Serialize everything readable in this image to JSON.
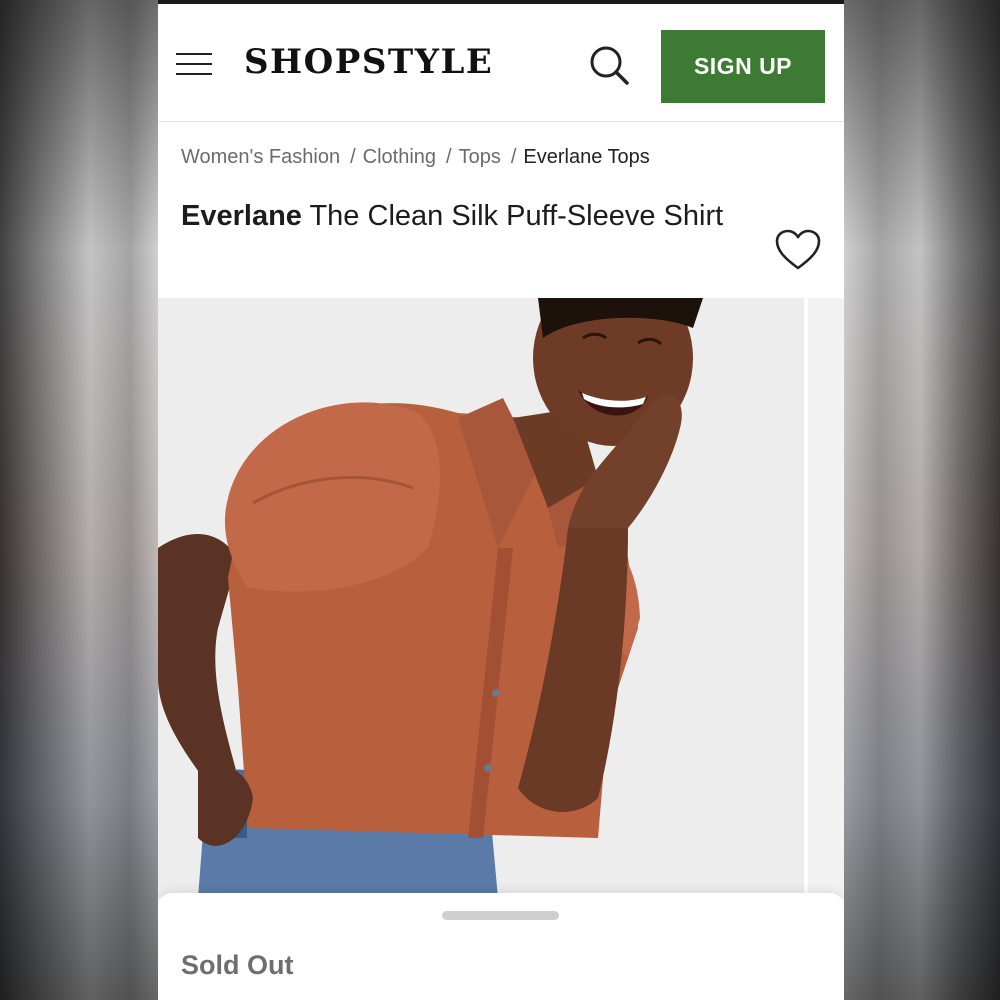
{
  "header": {
    "logo": "SHOPSTYLE",
    "signup_label": "SIGN UP",
    "accent_color": "#3d7a33",
    "icons": [
      "hamburger-menu-icon",
      "search-icon"
    ]
  },
  "breadcrumb": {
    "items": [
      "Women's Fashion",
      "Clothing",
      "Tops"
    ],
    "current": "Everlane Tops",
    "separator": "/"
  },
  "product": {
    "brand": "Everlane",
    "name": "The Clean Silk Puff-Sleeve Shirt",
    "favorite_icon": "heart-outline-icon",
    "shirt_color": "#b85f3e",
    "jeans_color": "#5b7aa8"
  },
  "sheet": {
    "status": "Sold Out"
  }
}
